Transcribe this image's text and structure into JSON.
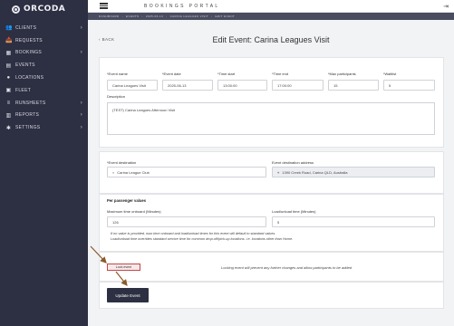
{
  "app": {
    "logo_text": "ORCODA",
    "portal_title": "BOOKINGS PORTAL"
  },
  "sidebar": {
    "items": [
      {
        "label": "CLIENTS",
        "icon": "users-icon",
        "glyph": "👥",
        "has_children": true
      },
      {
        "label": "REQUESTS",
        "icon": "inbox-icon",
        "glyph": "📥",
        "has_children": false
      },
      {
        "label": "BOOKINGS",
        "icon": "calendar-icon",
        "glyph": "▦",
        "has_children": true
      },
      {
        "label": "EVENTS",
        "icon": "events-icon",
        "glyph": "▤",
        "has_children": false
      },
      {
        "label": "LOCATIONS",
        "icon": "location-icon",
        "glyph": "●",
        "has_children": false
      },
      {
        "label": "FLEET",
        "icon": "bus-icon",
        "glyph": "▣",
        "has_children": false
      },
      {
        "label": "RUNSHEETS",
        "icon": "list-icon",
        "glyph": "≡",
        "has_children": true
      },
      {
        "label": "REPORTS",
        "icon": "report-icon",
        "glyph": "▥",
        "has_children": true
      },
      {
        "label": "SETTINGS",
        "icon": "gear-icon",
        "glyph": "✱",
        "has_children": true
      }
    ]
  },
  "breadcrumb": [
    "DASHBOARD",
    "EVENTS",
    "2025-06-13",
    "CARINA LEAGUES VISIT",
    "EDIT EVENT"
  ],
  "page": {
    "back_label": "BACK",
    "title": "Edit Event: Carina Leagues Visit"
  },
  "form": {
    "event_name": {
      "label": "*Event name",
      "value": "Carina Leagues Visit"
    },
    "event_date": {
      "label": "*Event date",
      "value": "2025-06-13"
    },
    "time_start": {
      "label": "*Time start",
      "value": "13:00:00"
    },
    "time_end": {
      "label": "*Time end",
      "value": "17:00:00"
    },
    "max_participants": {
      "label": "*Max participants",
      "value": "15"
    },
    "waitlist": {
      "label": "*Waitlist",
      "value": "5"
    },
    "description": {
      "label": "Description",
      "value": "(TEST) Carina Leagues Afternoon Visit"
    },
    "event_destination": {
      "label": "*Event destination",
      "value": "Carina League Club"
    },
    "event_destination_address": {
      "label": "Event destination address",
      "value": "1390 Creek Road, Carina QLD, Australia"
    },
    "per_passenger_title": "Per passenger values",
    "max_time_onboard": {
      "label": "Maximum time onboard (Minutes)",
      "value": "126"
    },
    "load_unload_time": {
      "label": "Load/unload time (Minutes)",
      "value": "5"
    },
    "note_line1": "If no value is provided, max time onboard and load/unload times for this event will default to standard values.",
    "note_line2": "Load/unload time overrides standard service time for common drop-off/pick-up locations. i.e. locations other than Home.",
    "lock_event_label": "Lock event",
    "lock_note": "Locking event will prevent any further changes and allow participants to be added",
    "update_button": "Update Event"
  },
  "colors": {
    "sidebar_bg": "#2d2f42",
    "annotation_arrow": "#8a5a2b",
    "lock_border": "#c64646"
  }
}
